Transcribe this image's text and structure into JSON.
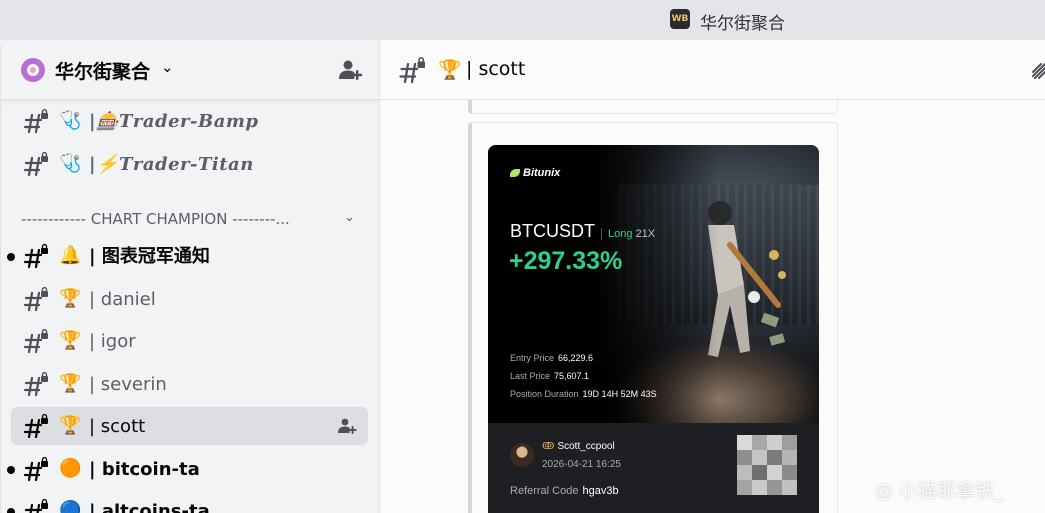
{
  "window": {
    "title": "华尔街聚合",
    "app_icon_text": "WB"
  },
  "server": {
    "name": "华尔街聚合",
    "chevron": "⌄"
  },
  "channels": [
    {
      "emoji": "🩺",
      "name": "|🎰𝑻𝒓𝒂𝒅𝒆𝒓-𝑩𝒂𝒎𝒑",
      "style": "script"
    },
    {
      "emoji": "🩺",
      "name": "|⚡𝑻𝒓𝒂𝒅𝒆𝒓-𝑻𝒊𝒕𝒂𝒏",
      "style": "script"
    },
    {
      "emoji": "🔔",
      "name": "| 图表冠军通知",
      "style": "bold",
      "unread": true
    },
    {
      "emoji": "🏆",
      "name": "| daniel"
    },
    {
      "emoji": "🏆",
      "name": "| igor"
    },
    {
      "emoji": "🏆",
      "name": "| severin"
    },
    {
      "emoji": "🏆",
      "name": "| scott",
      "active": true
    },
    {
      "emoji": "🟠",
      "name": "| bitcoin-ta",
      "style": "bold",
      "unread": true
    },
    {
      "emoji": "🔵",
      "name": "| altcoins-ta",
      "style": "bold",
      "unread": true
    }
  ],
  "category": {
    "label": "------------ CHART CHAMPION --------...",
    "chevron": "⌄"
  },
  "header": {
    "emoji": "🏆",
    "title": "| scott"
  },
  "card": {
    "brand": "Bitunix",
    "pair": "BTCUSDT",
    "side": "Long",
    "leverage": "21X",
    "roi": "+297.33%",
    "entry_label": "Entry Price",
    "entry_value": "66,229.6",
    "last_label": "Last Price",
    "last_value": "75,607.1",
    "duration_label": "Position Duration",
    "duration_value": "19D 14H 52M 43S",
    "handle_mark": "ↂ",
    "handle": "Scott_ccpool",
    "datetime": "2026-04-21 16:25",
    "referral_label": "Referral Code",
    "referral_code": "hgav3b"
  },
  "watermark": {
    "text": "@ 小猫耶拿铁_"
  }
}
